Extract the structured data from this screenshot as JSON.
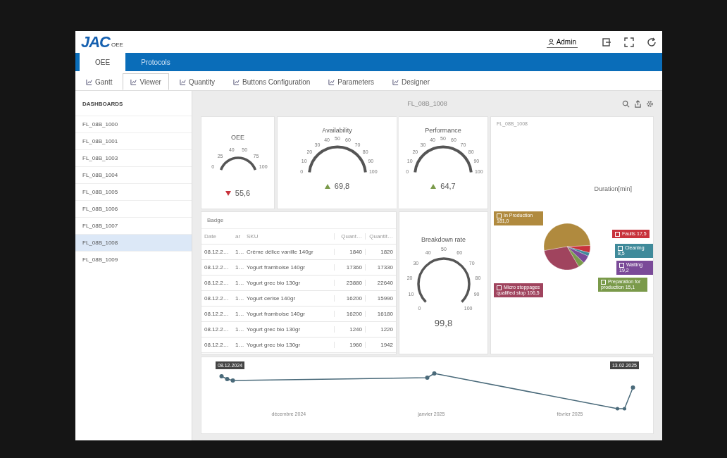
{
  "header": {
    "logo": "JAC",
    "app_name": "OEE",
    "user": "Admin"
  },
  "tabs": [
    {
      "label": "OEE",
      "selected": true
    },
    {
      "label": "Protocols",
      "selected": false
    }
  ],
  "subtabs": [
    {
      "label": "Gantt",
      "selected": false
    },
    {
      "label": "Viewer",
      "selected": true
    },
    {
      "label": "Quantity",
      "selected": false
    },
    {
      "label": "Buttons Configuration",
      "selected": false
    },
    {
      "label": "Parameters",
      "selected": false
    },
    {
      "label": "Designer",
      "selected": false
    }
  ],
  "sidebar": {
    "heading": "DASHBOARDS",
    "items": [
      {
        "label": "FL_08B_1000",
        "selected": false
      },
      {
        "label": "FL_08B_1001",
        "selected": false
      },
      {
        "label": "FL_08B_1003",
        "selected": false
      },
      {
        "label": "FL_08B_1004",
        "selected": false
      },
      {
        "label": "FL_08B_1005",
        "selected": false
      },
      {
        "label": "FL_08B_1006",
        "selected": false
      },
      {
        "label": "FL_08B_1007",
        "selected": false
      },
      {
        "label": "FL_08B_1008",
        "selected": true
      },
      {
        "label": "FL_08B_1009",
        "selected": false
      }
    ]
  },
  "dashboard": {
    "title": "FL_08B_1008",
    "gauges": [
      {
        "title": "OEE",
        "value": "55,6",
        "rising": false,
        "ticks": [
          "0",
          "25",
          "40",
          "50",
          "75",
          "100"
        ]
      },
      {
        "title": "Availability",
        "value": "69,8",
        "rising": true,
        "ticks": [
          "0",
          "10",
          "20",
          "30",
          "40",
          "50",
          "60",
          "70",
          "80",
          "90",
          "100"
        ]
      },
      {
        "title": "Performance",
        "value": "64,7",
        "rising": true,
        "ticks": [
          "0",
          "10",
          "20",
          "30",
          "40",
          "50",
          "60",
          "70",
          "80",
          "90",
          "100"
        ]
      },
      {
        "title": "Breakdown rate",
        "value": "99,8",
        "ticks": [
          "0",
          "10",
          "20",
          "30",
          "40",
          "50",
          "60",
          "70",
          "80",
          "90",
          "100"
        ]
      }
    ],
    "table": {
      "title": "Badge",
      "columns": [
        "Date",
        "ar",
        "SKU",
        "Quant…",
        "Quantit…"
      ],
      "rows": [
        [
          "08.12.2…",
          "1…",
          "Crème délice vanille 140gr",
          "1840",
          "1820"
        ],
        [
          "08.12.2…",
          "1…",
          "Yogurt framboise 140gr",
          "17360",
          "17330"
        ],
        [
          "08.12.2…",
          "1…",
          "Yogurt grec bio 130gr",
          "23880",
          "22640"
        ],
        [
          "08.12.2…",
          "1…",
          "Yogurt cerise 140gr",
          "16200",
          "15990"
        ],
        [
          "08.12.2…",
          "1…",
          "Yogurt framboise 140gr",
          "16200",
          "16180"
        ],
        [
          "08.12.2…",
          "1…",
          "Yogurt grec bio 130gr",
          "1240",
          "1220"
        ],
        [
          "08.12.2…",
          "1…",
          "Yogurt grec bio 130gr",
          "1960",
          "1942"
        ]
      ]
    },
    "pie": {
      "caption": "FL_08B_1008",
      "chart_data": {
        "type": "pie",
        "title": "Duration[min]",
        "categories": [
          "In Production",
          "Faults",
          "Cleaning",
          "Waiting",
          "Preparation for production",
          "Micro stoppages qualified stop"
        ],
        "values": [
          181.0,
          17.5,
          8.5,
          19.2,
          15.1,
          106.5
        ],
        "value_labels": [
          "181,0",
          "17,5",
          "8,5",
          "19,2",
          "15,1",
          "106,5"
        ],
        "legend": "bottom-right",
        "colors": [
          "#b08a3e",
          "#c8323c",
          "#3f8a9a",
          "#7a4a98",
          "#7a9a4a",
          "#a0445e"
        ]
      }
    },
    "trend": {
      "badges": [
        "08.12.2024",
        "13.02.2025"
      ],
      "x_labels": [
        "décembre 2024",
        "janvier 2025",
        "février 2025"
      ]
    }
  }
}
